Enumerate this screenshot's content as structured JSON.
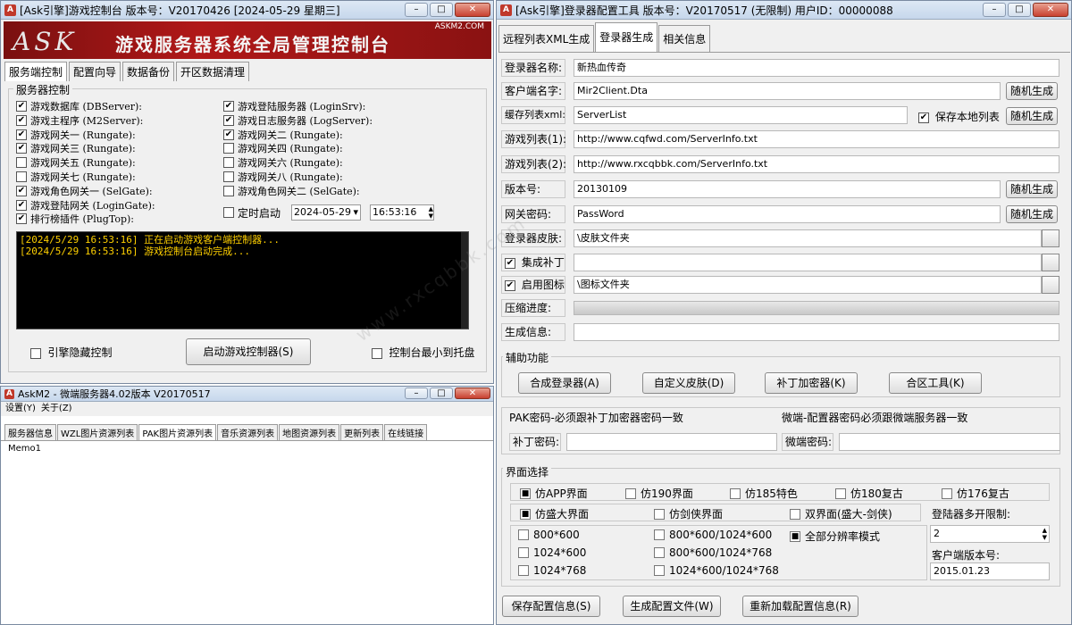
{
  "console": {
    "title": "[Ask引擎]游戏控制台 版本号：V20170426 [2024-05-29 星期三]",
    "banner": {
      "logo": "ASK",
      "url": "ASKM2.COM",
      "headline": "游戏服务器系统全局管理控制台"
    },
    "tabs": [
      "服务端控制",
      "配置向导",
      "数据备份",
      "开区数据清理"
    ],
    "group_title": "服务器控制",
    "left_servers": [
      {
        "label": "游戏数据库 (DBServer):",
        "checked": true
      },
      {
        "label": "游戏主程序 (M2Server):",
        "checked": true
      },
      {
        "label": "游戏网关一 (Rungate):",
        "checked": true
      },
      {
        "label": "游戏网关三 (Rungate):",
        "checked": true
      },
      {
        "label": "游戏网关五 (Rungate):",
        "checked": false
      },
      {
        "label": "游戏网关七 (Rungate):",
        "checked": false
      },
      {
        "label": "游戏角色网关一 (SelGate):",
        "checked": true
      },
      {
        "label": "游戏登陆网关 (LoginGate):",
        "checked": true
      },
      {
        "label": "排行榜插件 (PlugTop):",
        "checked": true
      }
    ],
    "right_servers": [
      {
        "label": "游戏登陆服务器 (LoginSrv):",
        "checked": true
      },
      {
        "label": "游戏日志服务器 (LogServer):",
        "checked": true
      },
      {
        "label": "游戏网关二 (Rungate):",
        "checked": true
      },
      {
        "label": "游戏网关四 (Rungate):",
        "checked": false
      },
      {
        "label": "游戏网关六 (Rungate):",
        "checked": false
      },
      {
        "label": "游戏网关八 (Rungate):",
        "checked": false
      },
      {
        "label": "游戏角色网关二 (SelGate):",
        "checked": false
      }
    ],
    "timer": {
      "label": "定时启动",
      "date": "2024-05-29",
      "time": "16:53:16"
    },
    "log_lines": [
      "[2024/5/29 16:53:16] 正在启动游戏客户端控制器...",
      "[2024/5/29 16:53:16] 游戏控制台启动完成..."
    ],
    "hide_engine": "引擎隐藏控制",
    "start_button": "启动游戏控制器(S)",
    "min_tray": "控制台最小到托盘"
  },
  "m2": {
    "title": "AskM2 - 微端服务器4.02版本 V20170517",
    "menu": [
      "设置(Y)",
      "关于(Z)"
    ],
    "tabs": [
      "服务器信息",
      "WZL图片资源列表",
      "PAK图片资源列表",
      "音乐资源列表",
      "地图资源列表",
      "更新列表",
      "在线链接"
    ],
    "memo": "Memo1"
  },
  "login": {
    "title": "[Ask引擎]登录器配置工具 版本号：V20170517 (无限制) 用户ID：00000088",
    "tabs": [
      "远程列表XML生成",
      "登录器生成",
      "相关信息"
    ],
    "fields": {
      "name_label": "登录器名称:",
      "name_value": "新热血传奇",
      "client_label": "客户端名字:",
      "client_value": "Mir2Client.Dta",
      "cache_label": "缓存列表xml:",
      "cache_value": "ServerList",
      "save_local": "保存本地列表",
      "list1_label": "游戏列表(1):",
      "list1_value": "http://www.cqfwd.com/ServerInfo.txt",
      "list2_label": "游戏列表(2):",
      "list2_value": "http://www.rxcqbbk.com/ServerInfo.txt",
      "version_label": "版本号:",
      "version_value": "20130109",
      "pwd_label": "网关密码:",
      "pwd_value": "PassWord",
      "skin_label": "登录器皮肤:",
      "skin_value": "\\皮肤文件夹",
      "patch_label": "集成补丁",
      "patch_value": "",
      "icon_label": "启用图标",
      "icon_value": "\\图标文件夹",
      "progress_label": "压缩进度:",
      "progress": 0,
      "info_label": "生成信息:",
      "info_value": ""
    },
    "random_button": "随机生成",
    "aux": {
      "title": "辅助功能",
      "buttons": [
        "合成登录器(A)",
        "自定义皮肤(D)",
        "补丁加密器(K)",
        "合区工具(K)"
      ]
    },
    "pak_note": "PAK密码-必须跟补丁加密器密码一致",
    "micro_note": "微端-配置器密码必须跟微端服务器一致",
    "patch_pwd_label": "补丁密码:",
    "patch_pwd_value": "",
    "micro_pwd_label": "微端密码:",
    "micro_pwd_value": "",
    "ui": {
      "title": "界面选择",
      "row1": [
        {
          "label": "仿APP界面",
          "selected": true
        },
        {
          "label": "仿190界面",
          "selected": false
        },
        {
          "label": "仿185特色",
          "selected": false
        },
        {
          "label": "仿180复古",
          "selected": false
        },
        {
          "label": "仿176复古",
          "selected": false
        }
      ],
      "row2": [
        {
          "label": "仿盛大界面",
          "selected": true
        },
        {
          "label": "仿剑侠界面",
          "selected": false
        },
        {
          "label": "双界面(盛大-剑侠)",
          "selected": false
        }
      ],
      "res": [
        {
          "label": "800*600",
          "selected": false
        },
        {
          "label": "800*600/1024*600",
          "selected": false
        },
        {
          "label": "全部分辨率模式",
          "selected": true
        },
        {
          "label": "1024*600",
          "selected": false
        },
        {
          "label": "800*600/1024*768",
          "selected": false
        },
        {
          "label": "1024*768",
          "selected": false
        },
        {
          "label": "1024*600/1024*768",
          "selected": false
        }
      ],
      "multi_label": "登陆器多开限制:",
      "multi_value": "2",
      "client_ver_label": "客户端版本号:",
      "client_ver_value": "2015.01.23"
    },
    "buttons": [
      "保存配置信息(S)",
      "生成配置文件(W)",
      "重新加载配置信息(R)"
    ]
  },
  "watermark": "www.rxcqbbk.com",
  "colors": {
    "log_text": "#ffd000",
    "banner_red": "#b01010",
    "title_bg": "#d2e0f0"
  }
}
